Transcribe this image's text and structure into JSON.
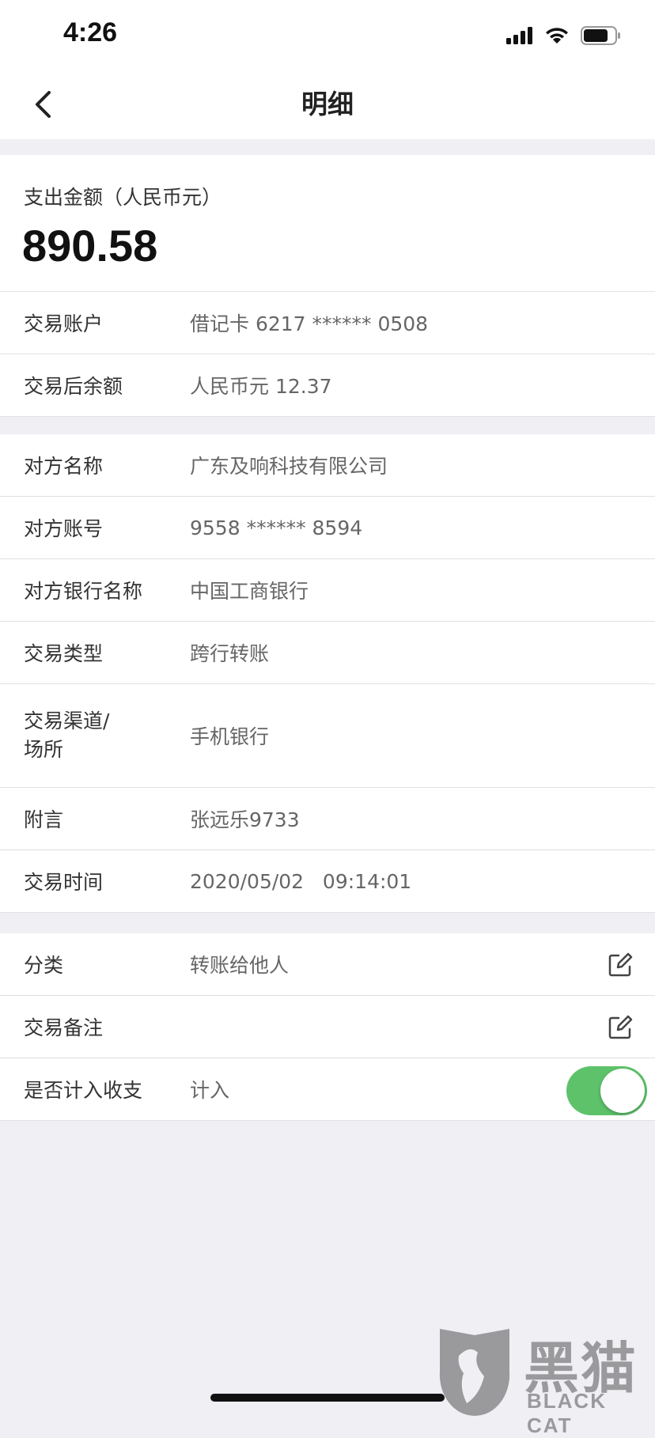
{
  "status_bar": {
    "time": "4:26"
  },
  "nav": {
    "title": "明细"
  },
  "amount": {
    "label": "支出金额（人民币元）",
    "value": "890.58"
  },
  "section1": [
    {
      "label": "交易账户",
      "value": "借记卡 6217 ****** 0508"
    },
    {
      "label": "交易后余额",
      "value": "人民币元 12.37"
    }
  ],
  "section2": [
    {
      "label": "对方名称",
      "value": "广东及响科技有限公司"
    },
    {
      "label": "对方账号",
      "value": "9558 ****** 8594"
    },
    {
      "label": "对方银行名称",
      "value": "中国工商银行"
    },
    {
      "label": "交易类型",
      "value": "跨行转账"
    },
    {
      "label": "交易渠道/\n场所",
      "value": "手机银行"
    },
    {
      "label": "附言",
      "value": "张远乐9733"
    },
    {
      "label": "交易时间",
      "value": "2020/05/02   09:14:01"
    }
  ],
  "section3": [
    {
      "label": "分类",
      "value": "转账给他人"
    },
    {
      "label": "交易备注",
      "value": ""
    },
    {
      "label": "是否计入收支",
      "value": "计入",
      "toggle_on": true
    }
  ],
  "watermark": {
    "text": "黑猫",
    "sub": "BLACK CAT"
  },
  "colors": {
    "toggle_on": "#5ec26a",
    "background": "#efeff4"
  }
}
